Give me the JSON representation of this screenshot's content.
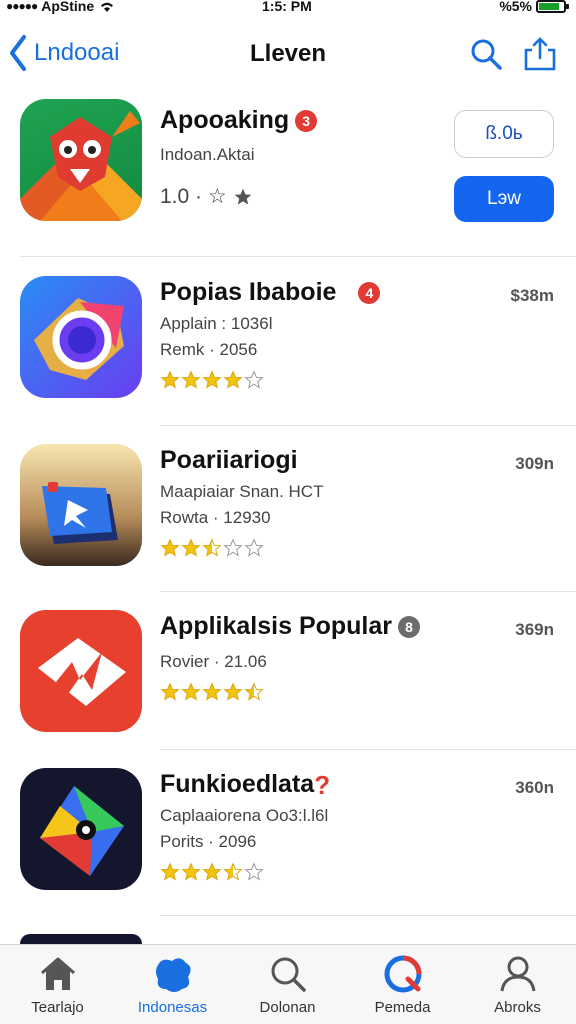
{
  "status": {
    "carrier": "ApStine",
    "time": "1:5: PM",
    "battery": "%5%"
  },
  "nav": {
    "back_label": "Lndooai",
    "title": "Lleven"
  },
  "featured": {
    "name": "Apooaking",
    "badge": "3",
    "subtitle": "Indoan.Aktai",
    "rating_text": "1.0 · ☆",
    "price_label": "ß.0ь",
    "action_label": "Lэw"
  },
  "apps": [
    {
      "name": "Popias Ibaboie",
      "badge": "4",
      "badge_color": "#e23b35",
      "size": "$38m",
      "sub": "Applain : 1036l",
      "meta": "Remk · 2056",
      "rating": 4
    },
    {
      "name": "Poariiariogi",
      "badge": "",
      "size": "309n",
      "sub": "Maapiaiar Snan. HCT",
      "meta": "Rowta · 12930",
      "rating": 2.5
    },
    {
      "name": "Applikalsis Popular",
      "badge": "8",
      "badge_color": "#6c6c6c",
      "size": "369n",
      "sub": "",
      "meta": "Rovier · 21.06",
      "rating": 4.5
    },
    {
      "name": "Funkioedlata",
      "badge": "?",
      "badge_color": "#e23b35",
      "size": "360n",
      "sub": "Caplaaiorena Oo3:l.l6l",
      "meta": "Porits · 2096",
      "rating": 3.5
    }
  ],
  "tabs": [
    {
      "label": "Tearlajo",
      "icon": "home-icon"
    },
    {
      "label": "Indonesas",
      "icon": "apps-icon"
    },
    {
      "label": "Dolonan",
      "icon": "search-icon"
    },
    {
      "label": "Pemeda",
      "icon": "apple-arcade-icon"
    },
    {
      "label": "Abroks",
      "icon": "person-icon"
    }
  ],
  "colors": {
    "accent": "#1466f0",
    "star": "#f2c40f",
    "badge_red": "#e23b35"
  }
}
